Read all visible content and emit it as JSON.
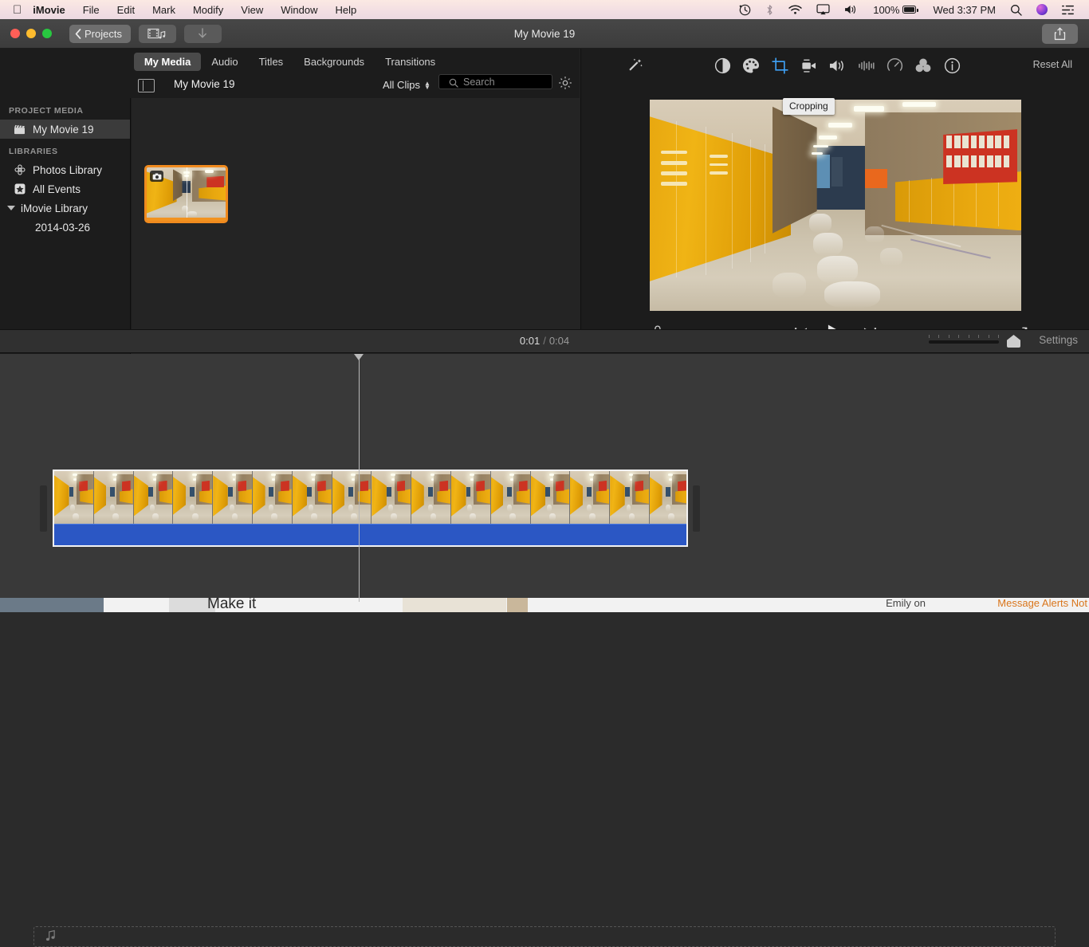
{
  "menubar": {
    "apple_icon": "apple-icon",
    "app_name": "iMovie",
    "items": [
      "File",
      "Edit",
      "Mark",
      "Modify",
      "View",
      "Window",
      "Help"
    ],
    "status": {
      "time_machine_icon": "time-machine-icon",
      "bluetooth_icon": "bluetooth-icon",
      "wifi_icon": "wifi-icon",
      "airplay_icon": "airplay-icon",
      "volume_icon": "volume-icon",
      "battery_percent": "100%",
      "battery_icon": "battery-charging-icon",
      "clock": "Wed 3:37 PM",
      "search_icon": "spotlight-search-icon",
      "siri_icon": "siri-icon",
      "control_center_icon": "control-center-icon"
    }
  },
  "titlebar": {
    "back_label": "Projects",
    "media_button_icon": "film-music-icon",
    "download_button_icon": "download-arrow-icon",
    "title": "My Movie 19",
    "share_icon": "share-export-icon"
  },
  "browser": {
    "tabs": [
      {
        "label": "My Media",
        "selected": true
      },
      {
        "label": "Audio",
        "selected": false
      },
      {
        "label": "Titles",
        "selected": false
      },
      {
        "label": "Backgrounds",
        "selected": false
      },
      {
        "label": "Transitions",
        "selected": false
      }
    ],
    "sidebar_toggle_icon": "sidebar-toggle-icon",
    "title": "My Movie 19",
    "filter_label": "All Clips",
    "search_placeholder": "Search",
    "search_value": "",
    "search_icon": "search-icon",
    "settings_icon": "gear-icon"
  },
  "sidebar": {
    "project_media_header": "PROJECT MEDIA",
    "project_item": {
      "label": "My Movie 19",
      "icon": "clapperboard-icon",
      "selected": true
    },
    "libraries_header": "LIBRARIES",
    "libraries": [
      {
        "label": "Photos Library",
        "icon": "photos-flower-icon"
      },
      {
        "label": "All Events",
        "icon": "star-icon"
      },
      {
        "label": "iMovie Library",
        "icon": "disclosure-triangle-icon"
      }
    ],
    "events": [
      "2014-03-26"
    ]
  },
  "media": {
    "clip_badge_icon": "camera-badge-icon",
    "clip_alt": "school-hallway-lockers-thumbnail"
  },
  "viewer": {
    "tools": [
      {
        "name": "enhance-magic-wand",
        "label": "Auto Enhance",
        "active": false
      },
      {
        "name": "color-balance",
        "label": "Color Balance",
        "active": false
      },
      {
        "name": "color-correction-palette",
        "label": "Color Correction",
        "active": false
      },
      {
        "name": "cropping",
        "label": "Cropping",
        "active": true
      },
      {
        "name": "stabilization-camera",
        "label": "Stabilization",
        "active": false
      },
      {
        "name": "volume-speaker",
        "label": "Volume",
        "active": false
      },
      {
        "name": "noise-reduction-equalizer",
        "label": "Noise Reduction and Equalizer",
        "active": false
      },
      {
        "name": "speed-gauge",
        "label": "Speed",
        "active": false
      },
      {
        "name": "clip-filter-circles",
        "label": "Clip Filter and Audio Effects",
        "active": false
      },
      {
        "name": "information",
        "label": "Information",
        "active": false
      }
    ],
    "reset_all": "Reset All",
    "tooltip": "Cropping",
    "preview_alt": "school-hallway-with-yellow-lockers",
    "playback": {
      "voiceover_icon": "microphone-icon",
      "previous_icon": "skip-to-start-icon",
      "play_icon": "play-icon",
      "next_icon": "skip-to-end-icon",
      "fullscreen_icon": "expand-fullscreen-icon"
    }
  },
  "timeline": {
    "current_time": "0:01",
    "separator": "/",
    "total_time": "0:04",
    "zoom_slider_label": "zoom-slider",
    "settings_label": "Settings",
    "clip_alt": "timeline-video-clip-filmstrip",
    "music_drop_icon": "music-note-icon",
    "music_drop_label": ""
  },
  "background_window": {
    "text_left": "Make it",
    "text_orange": "Message Alerts Not",
    "text_gray": "Emily on"
  }
}
